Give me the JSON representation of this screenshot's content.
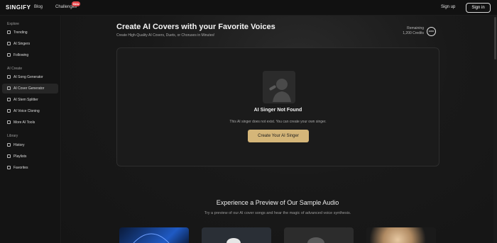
{
  "header": {
    "logo": "SINGIFY",
    "nav": [
      "Blog",
      "Challenges"
    ],
    "badge": "New",
    "signup": "Sign up",
    "signin": "Sign in"
  },
  "sidebar": {
    "sections": [
      {
        "label": "Explore",
        "items": [
          {
            "label": "Trending",
            "icon": "trending-icon"
          },
          {
            "label": "AI Singers",
            "icon": "mic-icon"
          },
          {
            "label": "Following",
            "icon": "heart-icon"
          }
        ]
      },
      {
        "label": "AI Create",
        "items": [
          {
            "label": "AI Song Generator",
            "icon": "music-icon"
          },
          {
            "label": "AI Cover Generator",
            "icon": "cover-icon",
            "active": true
          },
          {
            "label": "AI Stem Splitter",
            "icon": "split-icon"
          },
          {
            "label": "AI Voice Cloning",
            "icon": "voice-icon"
          },
          {
            "label": "More AI Tools",
            "icon": "grid-icon"
          }
        ]
      },
      {
        "label": "Library",
        "items": [
          {
            "label": "History",
            "icon": "history-icon"
          },
          {
            "label": "Playlists",
            "icon": "playlist-icon"
          },
          {
            "label": "Favorites",
            "icon": "star-icon"
          }
        ]
      }
    ]
  },
  "main": {
    "title": "Create AI Covers with your Favorite Voices",
    "subtitle": "Create High-Quality AI Covers, Duets, or Choruses in Minutes!",
    "credits_label": "Remaining",
    "credits_value": "1,200 Credits",
    "credits_ring": "100%",
    "card": {
      "title": "AI Singer Not Found",
      "description": "This AI singer does not exist. You can create your own singer.",
      "button": "Create Your AI Singer"
    },
    "preview": {
      "title": "Experience a Preview of Our Sample Audio",
      "description": "Try a preview of our AI cover songs and hear the magic of advanced voice synthesis."
    }
  },
  "colors": {
    "accent": "#d5b679",
    "background": "#141414"
  }
}
